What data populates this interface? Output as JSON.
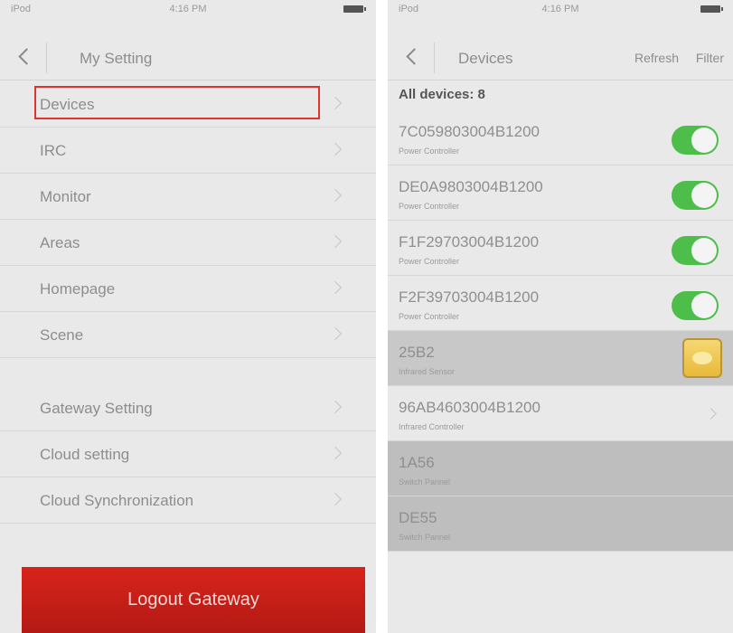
{
  "left": {
    "status": {
      "carrier": "iPod",
      "time": "4:16 PM"
    },
    "nav": {
      "title": "My Setting"
    },
    "menu_group_1": [
      {
        "label": "Devices"
      },
      {
        "label": "IRC"
      },
      {
        "label": "Monitor"
      },
      {
        "label": "Areas"
      },
      {
        "label": "Homepage"
      },
      {
        "label": "Scene"
      }
    ],
    "menu_group_2": [
      {
        "label": "Gateway Setting"
      },
      {
        "label": "Cloud setting"
      },
      {
        "label": "Cloud Synchronization"
      }
    ],
    "logout_label": "Logout Gateway"
  },
  "right": {
    "status": {
      "carrier": "iPod",
      "time": "4:16 PM"
    },
    "nav": {
      "title": "Devices",
      "refresh_label": "Refresh",
      "filter_label": "Filter"
    },
    "count_label": "All devices: 8",
    "devices": [
      {
        "id": "7C059803004B1200",
        "type": "Power Controller",
        "control": "toggle",
        "on": true
      },
      {
        "id": "DE0A9803004B1200",
        "type": "Power Controller",
        "control": "toggle",
        "on": true
      },
      {
        "id": "F1F29703004B1200",
        "type": "Power Controller",
        "control": "toggle",
        "on": true
      },
      {
        "id": "F2F39703004B1200",
        "type": "Power Controller",
        "control": "toggle",
        "on": true
      },
      {
        "id": "25B2",
        "type": "Infrared Sensor",
        "control": "sensor-icon"
      },
      {
        "id": "96AB4603004B1200",
        "type": "Infrared Controller",
        "control": "chevron"
      },
      {
        "id": "1A56",
        "type": "Switch Pannel",
        "control": "none"
      },
      {
        "id": "DE55",
        "type": "Switch Pannel",
        "control": "none"
      }
    ]
  },
  "colors": {
    "highlight": "#e0322f",
    "logout": "#c81f18",
    "toggle_on": "#4dbe4a"
  }
}
